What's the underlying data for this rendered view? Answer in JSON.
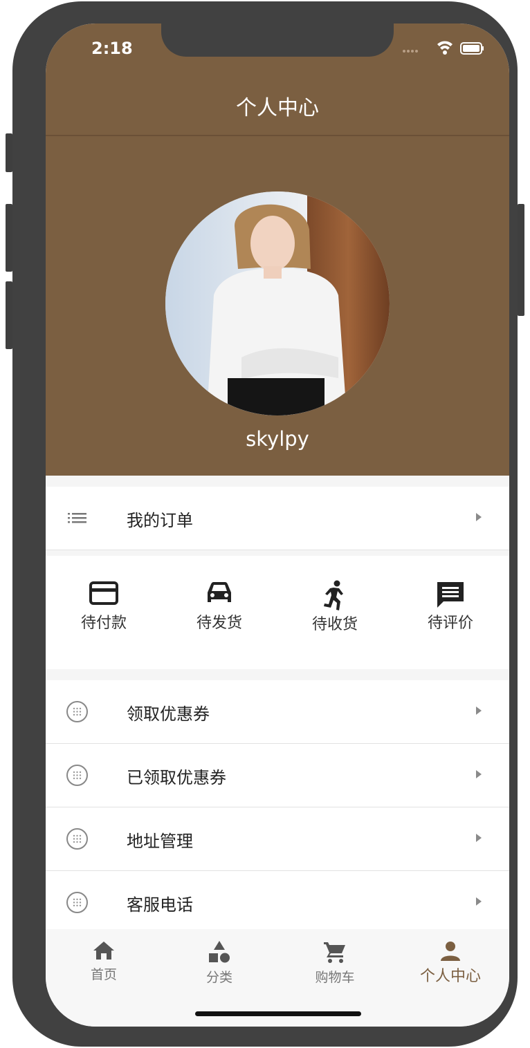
{
  "status_bar": {
    "time": "2:18"
  },
  "header": {
    "title": "个人中心"
  },
  "profile": {
    "username": "skylpy"
  },
  "my_orders": {
    "label": "我的订单"
  },
  "order_status": [
    {
      "label": "待付款",
      "icon": "credit-card-icon"
    },
    {
      "label": "待发货",
      "icon": "car-icon"
    },
    {
      "label": "待收货",
      "icon": "running-person-icon"
    },
    {
      "label": "待评价",
      "icon": "comment-icon"
    }
  ],
  "menu": [
    {
      "label": "领取优惠券",
      "icon": "dotted-circle-icon"
    },
    {
      "label": "已领取优惠券",
      "icon": "dotted-circle-icon"
    },
    {
      "label": "地址管理",
      "icon": "dotted-circle-icon"
    },
    {
      "label": "客服电话",
      "icon": "dotted-circle-icon"
    }
  ],
  "tabbar": [
    {
      "label": "首页",
      "icon": "home-icon"
    },
    {
      "label": "分类",
      "icon": "category-shapes-icon"
    },
    {
      "label": "购物车",
      "icon": "cart-icon"
    },
    {
      "label": "个人中心",
      "icon": "person-icon",
      "active": true
    }
  ],
  "colors": {
    "brand": "#7b5f41",
    "background": "#f5f5f5",
    "frame": "#414141"
  }
}
